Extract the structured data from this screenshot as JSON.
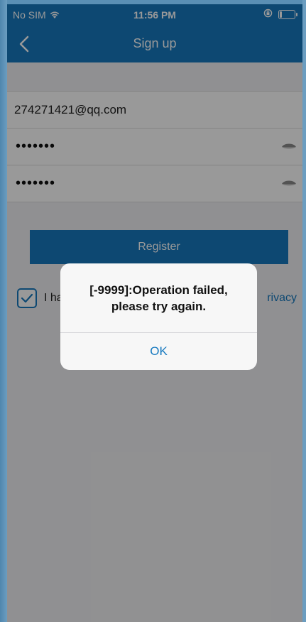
{
  "status_bar": {
    "carrier": "No SIM",
    "time": "11:56 PM",
    "icons": [
      "wifi-icon",
      "rotation-lock-icon",
      "battery-icon"
    ]
  },
  "nav": {
    "title": "Sign up",
    "back_icon": "chevron-left-icon"
  },
  "form": {
    "email_value": "274271421@qq.com",
    "password_mask": "•••••••",
    "confirm_password_mask": "•••••••",
    "eye_icon": "eye-icon"
  },
  "register": {
    "label": "Register"
  },
  "agreement": {
    "text_visible": "I ha",
    "link_visible": "rivacy",
    "checked": true
  },
  "alert": {
    "message_line1": "[-9999]:Operation failed,",
    "message_line2": "please try again.",
    "ok_label": "OK"
  },
  "colors": {
    "accent": "#1679bf",
    "background": "#f1f1f3"
  }
}
